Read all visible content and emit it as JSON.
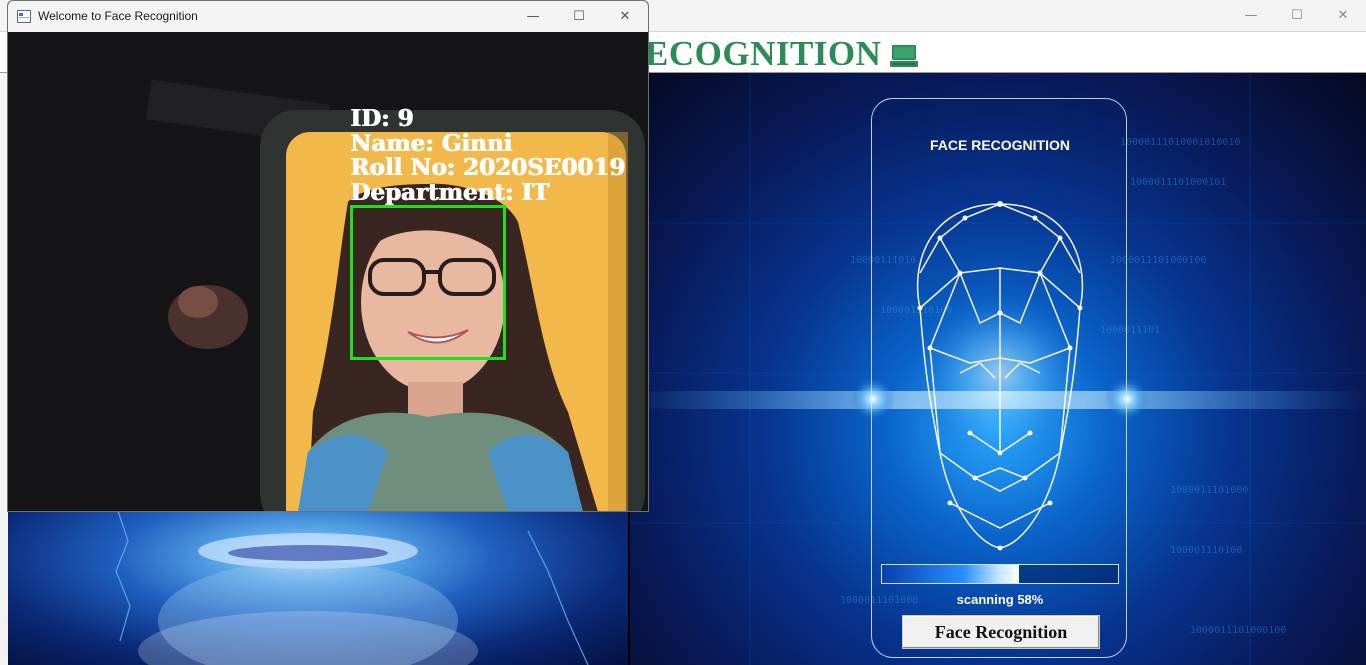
{
  "main_window": {
    "controls": {
      "minimize": "—",
      "maximize": "☐",
      "close": "✕"
    },
    "heading": "ECOGNITION"
  },
  "scan_panel": {
    "title": "FACE RECOGNITION",
    "progress_label": "scanning 58%",
    "progress_fraction": 0.58,
    "button_label": "Face Recognition"
  },
  "camera_window": {
    "title": "Welcome to Face Recognition",
    "controls": {
      "minimize": "—",
      "maximize": "☐",
      "close": "✕"
    },
    "overlay": {
      "id": "ID: 9",
      "name": "Name: Ginni",
      "roll": "Roll No: 2020SE0019",
      "department": "Department: IT"
    }
  },
  "colors": {
    "heading_green": "#2e8b57",
    "face_box_green": "#1ee01e",
    "progress_blue": "#2a8fff"
  }
}
